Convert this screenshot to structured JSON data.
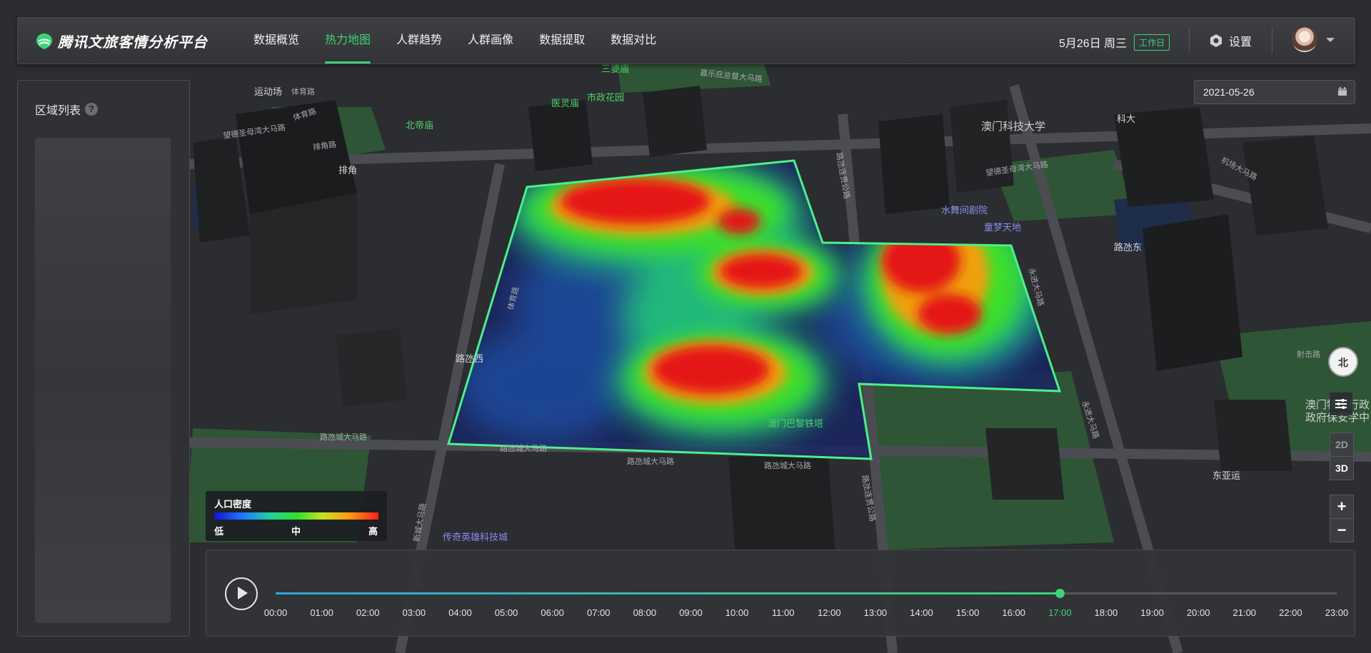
{
  "app": {
    "title": "腾讯文旅客情分析平台",
    "accent": "#3dd37a"
  },
  "nav": {
    "items": [
      {
        "label": "数据概览",
        "active": false
      },
      {
        "label": "热力地图",
        "active": true
      },
      {
        "label": "人群趋势",
        "active": false
      },
      {
        "label": "人群画像",
        "active": false
      },
      {
        "label": "数据提取",
        "active": false
      },
      {
        "label": "数据对比",
        "active": false
      }
    ]
  },
  "header": {
    "date_label": "5月26日 周三",
    "workday_badge": "工作日",
    "settings_label": "设置"
  },
  "left_panel": {
    "title": "区域列表",
    "help_glyph": "?"
  },
  "date_picker": {
    "value": "2021-05-26"
  },
  "legend": {
    "title": "人口密度",
    "low": "低",
    "mid": "中",
    "high": "高"
  },
  "map_controls": {
    "compass": "北",
    "mode_2d": "2D",
    "mode_3d": "3D",
    "active_mode": "3D",
    "zoom_in": "+",
    "zoom_out": "−"
  },
  "timeline": {
    "ticks": [
      "00:00",
      "01:00",
      "02:00",
      "03:00",
      "04:00",
      "05:00",
      "06:00",
      "07:00",
      "08:00",
      "09:00",
      "10:00",
      "11:00",
      "12:00",
      "13:00",
      "14:00",
      "15:00",
      "16:00",
      "17:00",
      "18:00",
      "19:00",
      "20:00",
      "21:00",
      "22:00",
      "23:00"
    ],
    "current": "17:00",
    "progress": 0.739
  },
  "map_labels": [
    {
      "text": "运动场"
    },
    {
      "text": "体育路"
    },
    {
      "text": "北帝庙"
    },
    {
      "text": "医灵庙"
    },
    {
      "text": "市政花园"
    },
    {
      "text": "三婆庙"
    },
    {
      "text": "排角"
    },
    {
      "text": "澳门科技大学"
    },
    {
      "text": "科大"
    },
    {
      "text": "水舞间剧院"
    },
    {
      "text": "童梦天地"
    },
    {
      "text": "路氹东"
    },
    {
      "text": "路氹西"
    },
    {
      "text": "澳门巴黎铁塔"
    },
    {
      "text": "传奇英雄科技城"
    },
    {
      "text": "东亚运"
    },
    {
      "text": "射击路"
    },
    {
      "text": "澳门特别行政"
    },
    {
      "text": "政府保安学中"
    },
    {
      "text": "嘉乐庇总督大马路"
    },
    {
      "text": "望德圣母湾大马路"
    },
    {
      "text": "路氹城大马路"
    },
    {
      "text": "路氹连贯公路"
    },
    {
      "text": "永进大马路"
    },
    {
      "text": "路氹连贯公路"
    },
    {
      "text": "路氹城大马路"
    },
    {
      "text": "路氹城大马路"
    },
    {
      "text": "新城大马路"
    },
    {
      "text": "永进大马路"
    },
    {
      "text": "机场大马路"
    },
    {
      "text": "望德圣母湾大马路"
    },
    {
      "text": "排角路"
    },
    {
      "text": "体育路"
    },
    {
      "text": "路氹城大马路"
    },
    {
      "text": "体育路"
    }
  ],
  "icons": {
    "logo": "logo-icon",
    "settings": "gear-icon",
    "calendar": "calendar-icon",
    "play": "play-icon",
    "layers": "layers-icon"
  }
}
